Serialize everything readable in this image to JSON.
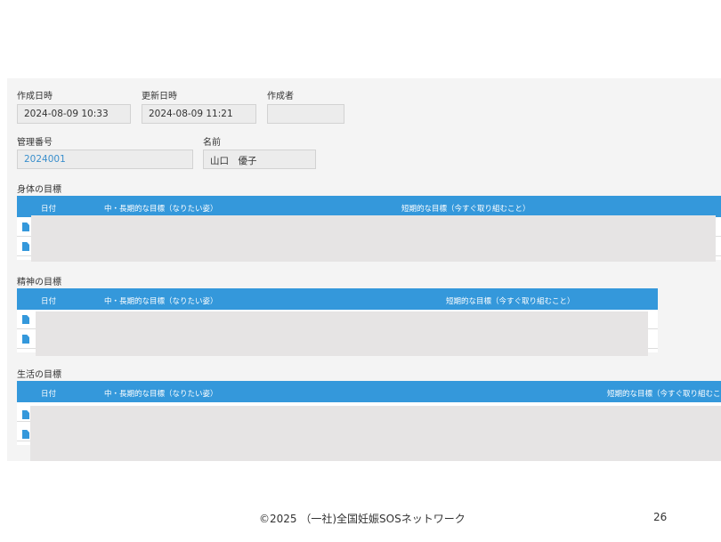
{
  "form": {
    "created_label": "作成日時",
    "created_value": "2024-08-09 10:33",
    "updated_label": "更新日時",
    "updated_value": "2024-08-09 11:21",
    "author_label": "作成者",
    "author_value": "",
    "id_label": "管理番号",
    "id_value": "2024001",
    "name_label": "名前",
    "name_value": "山口　優子"
  },
  "sections": {
    "body": {
      "title": "身体の目標",
      "col_date": "日付",
      "col_long": "中・長期的な目標（なりたい姿）",
      "col_short": "短期的な目標（今すぐ取り組むこと）"
    },
    "mind": {
      "title": "精神の目標",
      "col_date": "日付",
      "col_long": "中・長期的な目標（なりたい姿）",
      "col_short": "短期的な目標（今すぐ取り組むこと）"
    },
    "life": {
      "title": "生活の目標",
      "col_date": "日付",
      "col_long": "中・長期的な目標（なりたい姿）",
      "col_short": "短期的な目標（今すぐ取り組むこ"
    }
  },
  "footer": {
    "copyright": "©2025 （一社)全国妊娠SOSネットワーク",
    "page_number": "26"
  },
  "colors": {
    "header_blue": "#3498db",
    "panel_bg": "#f4f4f4",
    "mask_gray": "#e6e4e4"
  }
}
